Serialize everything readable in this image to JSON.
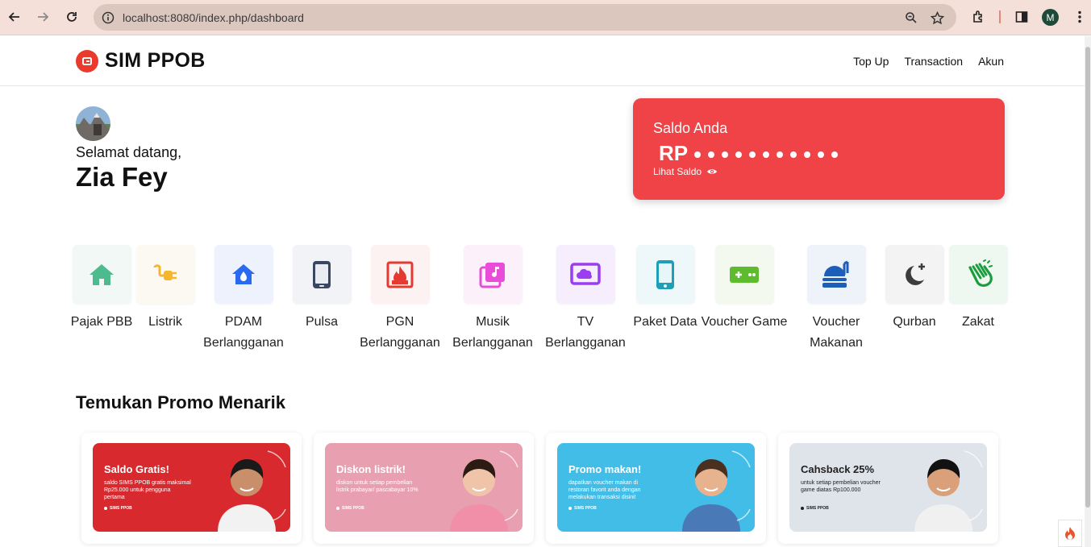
{
  "browser": {
    "url": "localhost:8080/index.php/dashboard",
    "profile_initial": "M"
  },
  "header": {
    "brand": "SIM PPOB",
    "nav": [
      "Top Up",
      "Transaction",
      "Akun"
    ]
  },
  "greeting": {
    "welcome": "Selamat datang,",
    "name": "Zia Fey"
  },
  "balance": {
    "label": "Saldo Anda",
    "currency": "RP",
    "masked_dots": 11,
    "toggle_label": "Lihat Saldo"
  },
  "services": [
    {
      "label": "Pajak PBB",
      "icon": "house-icon",
      "color": "#4dbb8e",
      "bg": "#f2f8f5"
    },
    {
      "label": "Listrik",
      "icon": "plug-icon",
      "color": "#f5b62e",
      "bg": "#fcf8f2"
    },
    {
      "label": "PDAM\nBerlangganan",
      "icon": "water-home-icon",
      "color": "#2a6af0",
      "bg": "#eef2fc"
    },
    {
      "label": "Pulsa",
      "icon": "phone-icon",
      "color": "#3b4660",
      "bg": "#f2f3f6"
    },
    {
      "label": "PGN\nBerlangganan",
      "icon": "gas-flame-icon",
      "color": "#e53a32",
      "bg": "#fcf2f2"
    },
    {
      "label": "Musik\nBerlangganan",
      "icon": "music-icon",
      "color": "#e94cd8",
      "bg": "#fcf0fb"
    },
    {
      "label": "TV\nBerlangganan",
      "icon": "tv-cloud-icon",
      "color": "#9b3ef0",
      "bg": "#f6eefd"
    },
    {
      "label": "Paket Data",
      "icon": "mobile-data-icon",
      "color": "#1e9fb8",
      "bg": "#eef8fa"
    },
    {
      "label": "Voucher Game",
      "icon": "gamepad-icon",
      "color": "#5fbb2e",
      "bg": "#f3f9ee"
    },
    {
      "label": "Voucher\nMakanan",
      "icon": "food-icon",
      "color": "#1d5fb8",
      "bg": "#eef3fa"
    },
    {
      "label": "Qurban",
      "icon": "moon-icon",
      "color": "#3c3c3c",
      "bg": "#f3f3f3"
    },
    {
      "label": "Zakat",
      "icon": "hands-icon",
      "color": "#1d9c3e",
      "bg": "#eef8f0"
    }
  ],
  "promo": {
    "title": "Temukan Promo Menarik",
    "cards": [
      {
        "heading": "Saldo Gratis!",
        "body": "saldo SIMS PPOB gratis maksimal Rp25.000 untuk pengguna pertama",
        "brand": "SIMS PPOB",
        "bg": "#d82a2e",
        "text_color": "#ffffff"
      },
      {
        "heading": "Diskon listrik!",
        "body": "diskon untuk setiap pembelian listrik prabayar/ pascabayar 10%",
        "brand": "SIMS PPOB",
        "bg": "#e8a0b0",
        "text_color": "#ffffff"
      },
      {
        "heading": "Promo makan!",
        "body": "dapatkan voucher makan di restoran favorit anda dengan melakukan transaksi disini!",
        "brand": "SIMS PPOB",
        "bg": "#42bde8",
        "text_color": "#ffffff"
      },
      {
        "heading": "Cahsback 25%",
        "body": "untuk setiap pembelian voucher game diatas Rp100.000",
        "brand": "SIMS PPOB",
        "bg": "#dfe3ea",
        "text_color": "#222222"
      }
    ]
  }
}
